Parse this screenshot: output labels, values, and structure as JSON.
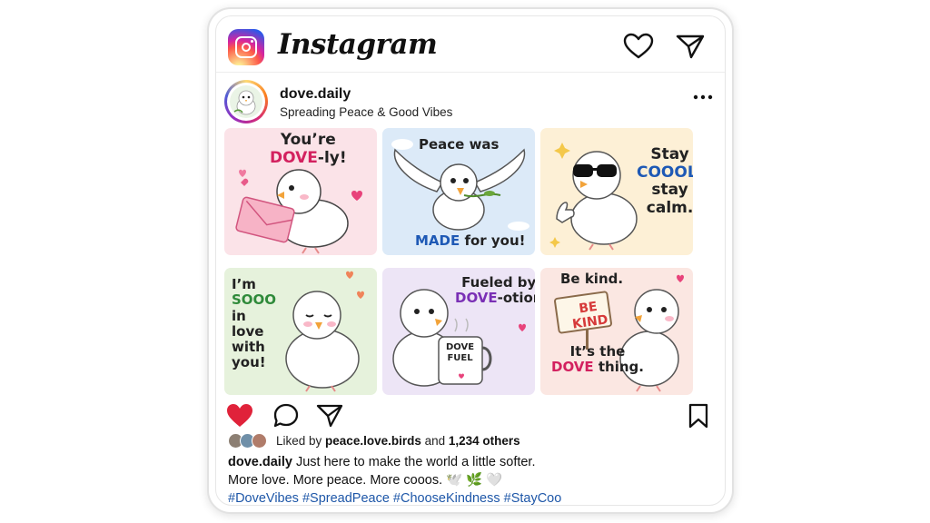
{
  "app": {
    "name": "Instagram"
  },
  "colors": {
    "accent_like": "#e0223a",
    "hashtag": "#1e57a8",
    "text": "#111111"
  },
  "header": {
    "icons": [
      "instagram-logo-icon",
      "heart-icon",
      "send-icon"
    ]
  },
  "post": {
    "username": "dove.daily",
    "bio": "Spreading Peace & Good Vibes",
    "tiles": [
      {
        "lines": [
          [
            "You’re",
            ""
          ],
          [
            "DOVE",
            "-ly!"
          ]
        ],
        "bg": "#fbe3e8"
      },
      {
        "lines": [
          [
            "Peace was"
          ],
          [
            "MADE",
            " for you!"
          ]
        ],
        "bg": "#dceaf8"
      },
      {
        "lines": [
          [
            "Stay"
          ],
          [
            "COOOL,"
          ],
          [
            "stay"
          ],
          [
            "calm."
          ]
        ],
        "bg": "#fdf0d6"
      },
      {
        "lines": [
          [
            "I’m"
          ],
          [
            "SOOO"
          ],
          [
            "in"
          ],
          [
            "love"
          ],
          [
            "with"
          ],
          [
            "you!"
          ]
        ],
        "bg": "#e6f2dc"
      },
      {
        "lines": [
          [
            "Fueled by"
          ],
          [
            "DOVE",
            "-otion"
          ]
        ],
        "bg": "#ede5f6",
        "mug": "DOVE\nFUEL"
      },
      {
        "lines": [
          [
            "Be kind."
          ],
          [
            "It’s the"
          ],
          [
            "DOVE",
            " thing."
          ]
        ],
        "bg": "#fbe7e2",
        "sign": "BE\nKIND"
      }
    ],
    "tile_text": {
      "t1a": "You’re",
      "t1b": "DOVE",
      "t1c": "-ly!",
      "t2a": "Peace was",
      "t2b": "MADE",
      "t2c": " for you!",
      "t3a": "Stay",
      "t3b": "COOOL,",
      "t3c": "stay",
      "t3d": "calm.",
      "t4a": "I’m",
      "t4b": "SOOO",
      "t4c": "in",
      "t4d": "love",
      "t4e": "with",
      "t4f": "you!",
      "t5a": "Fueled by",
      "t5b": "DOVE",
      "t5c": "-otion",
      "t5mug1": "DOVE",
      "t5mug2": "FUEL",
      "t6a": "Be kind.",
      "t6sign1": "BE",
      "t6sign2": "KIND",
      "t6b": "It’s the",
      "t6c": "DOVE",
      "t6d": " thing."
    },
    "liked_by": {
      "prefix": "Liked by ",
      "user": "peace.love.birds",
      "middle": " and ",
      "count": "1,234 others"
    },
    "caption": {
      "user": "dove.daily",
      "text": " Just here to make the world a little softer.",
      "line2": "More love. More peace. More cooos. 🕊️ 🌿 🤍",
      "hashtags": "#DoveVibes #SpreadPeace #ChooseKindness #StayCoo"
    },
    "liked": true
  }
}
